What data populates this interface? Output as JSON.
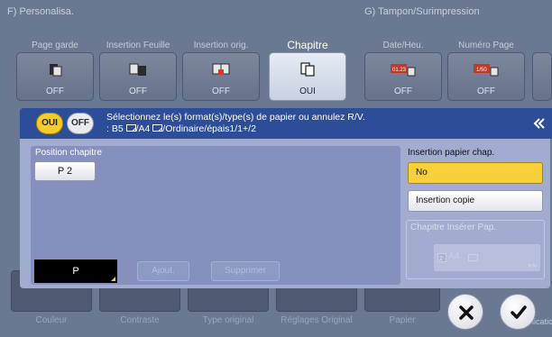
{
  "background": {
    "groups": [
      {
        "label": "F)  Personalisa."
      },
      {
        "label": "G)  Tampon/Surimpression"
      }
    ],
    "tabs": [
      {
        "name": "tab-page-garde",
        "label": "Page garde",
        "state": "OFF",
        "icon": "page-garde-icon"
      },
      {
        "name": "tab-insertion-feuille",
        "label": "Insertion Feuille",
        "state": "OFF",
        "icon": "insertion-feuille-icon"
      },
      {
        "name": "tab-insertion-orig",
        "label": "Insertion orig.",
        "state": "OFF",
        "icon": "insertion-orig-icon"
      },
      {
        "name": "tab-chapitre",
        "label": "Chapitre",
        "state": "OUI",
        "icon": "chapitre-icon",
        "active": true
      },
      {
        "name": "tab-date-heure",
        "label": "Date/Heu.",
        "state": "OFF",
        "icon": "date-heure-icon"
      },
      {
        "name": "tab-numero-page",
        "label": "Numéro Page",
        "state": "OFF",
        "icon": "numero-page-icon"
      }
    ],
    "date_icon_text": "01.23",
    "page_icon_text": "1/50",
    "bottom_items": [
      {
        "label": "Couleur"
      },
      {
        "label": "Contraste"
      },
      {
        "label": "Type original"
      },
      {
        "label": "Réglages Original"
      },
      {
        "label": "Papier"
      }
    ],
    "partial_label": "Application"
  },
  "dialog": {
    "oui_label": "OUI",
    "off_label": "OFF",
    "message_line1": "Sélectionnez le(s) format(s)/type(s) de papier ou annulez R/V.",
    "message_line2_a": ": B5",
    "message_line2_b": "/A4",
    "message_line2_c": "/Ordinaire/épais1/1+/2",
    "collapse_icon": "collapse-arrow-icon",
    "position_title": "Position chapitre",
    "position_value": "P 2",
    "page_input_value": "P",
    "add_label": "Ajout.",
    "delete_label": "Supprimer",
    "insertion_title": "Insertion papier chap.",
    "option_no": "No",
    "option_copie": "Insertion copie",
    "chapter_paper_title": "Chapitre Insérer Pap.",
    "chapter_paper_value": "A4",
    "accent_yellow": "#f6cd28",
    "header_blue": "#2d4d98",
    "body_lavender": "#a2acd0"
  },
  "actions": {
    "cancel_icon": "close-x-icon",
    "ok_icon": "check-icon"
  }
}
